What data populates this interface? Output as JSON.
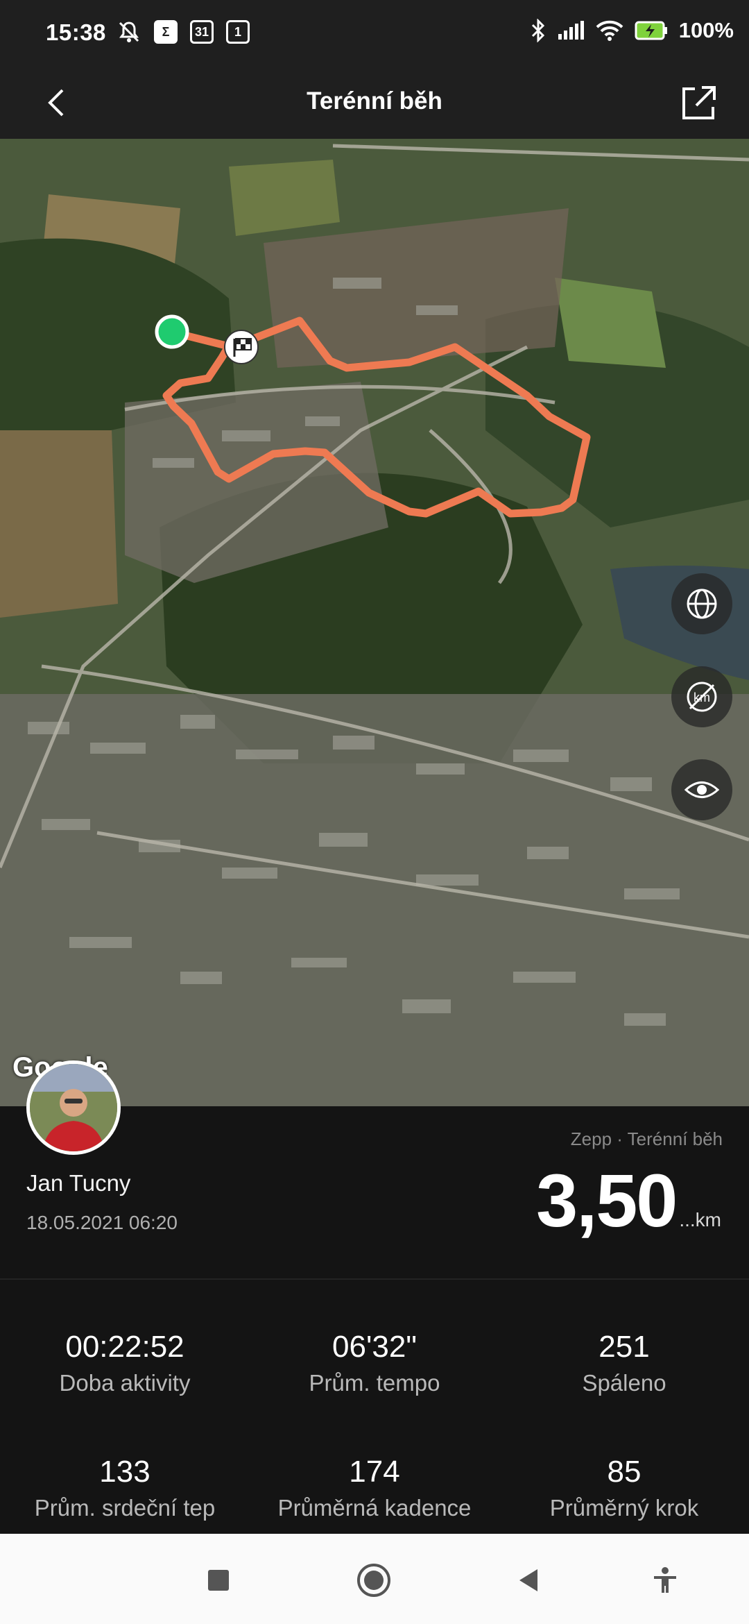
{
  "status_bar": {
    "time": "15:38",
    "calendar_day": "31",
    "notif_count": "1",
    "battery": "100%",
    "icons": [
      "mute-icon",
      "sigma-icon",
      "calendar-icon",
      "badge-icon",
      "bluetooth-icon",
      "signal-icon",
      "wifi-icon",
      "battery-charging-icon"
    ]
  },
  "header": {
    "title": "Terénní běh",
    "back_icon": "back-chevron-icon",
    "share_icon": "share-icon"
  },
  "map": {
    "attribution": "Google",
    "route_color": "#ee7a52",
    "start_color": "#1fcb6f",
    "buttons": [
      "globe-icon",
      "km-toggle-icon",
      "eye-icon"
    ]
  },
  "activity": {
    "user_name": "Jan Tucny",
    "datetime": "18.05.2021 06:20",
    "source": "Zepp · Terénní běh",
    "distance": "3,50",
    "distance_unit": "...km"
  },
  "stats": [
    {
      "value": "00:22:52",
      "label": "Doba aktivity"
    },
    {
      "value": "06'32\"",
      "label": "Prům. tempo"
    },
    {
      "value": "251",
      "label": "Spáleno"
    },
    {
      "value": "133",
      "label": "Prům. srdeční tep"
    },
    {
      "value": "174",
      "label": "Průměrná kadence"
    },
    {
      "value": "85",
      "label": "Průměrný krok"
    }
  ],
  "nav_bar": [
    "recents-square-icon",
    "home-circle-icon",
    "back-triangle-icon",
    "accessibility-icon"
  ]
}
